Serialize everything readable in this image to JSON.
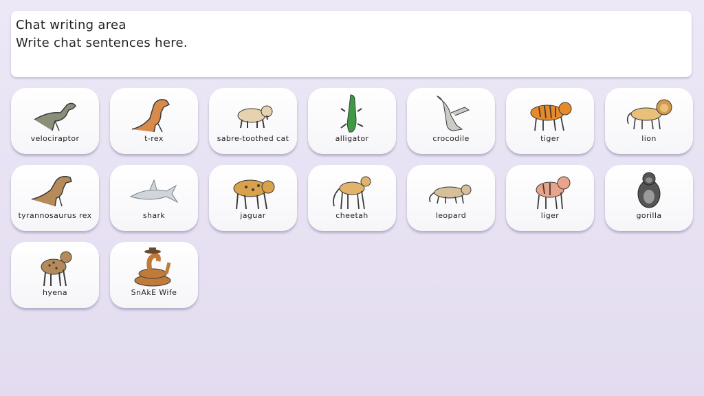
{
  "chat": {
    "title": "Chat writing area",
    "placeholder": "Write chat sentences here."
  },
  "tiles": [
    {
      "label": "velociraptor",
      "icon": "velociraptor-icon",
      "color": "#8a8f7a"
    },
    {
      "label": "t-rex",
      "icon": "t-rex-icon",
      "color": "#d88a4a"
    },
    {
      "label": "sabre-toothed cat",
      "icon": "sabre-toothed-cat-icon",
      "color": "#e6d2b0"
    },
    {
      "label": "alligator",
      "icon": "alligator-icon",
      "color": "#3e9a43"
    },
    {
      "label": "crocodile",
      "icon": "crocodile-icon",
      "color": "#c9ccc4"
    },
    {
      "label": "tiger",
      "icon": "tiger-icon",
      "color": "#e88a2a"
    },
    {
      "label": "lion",
      "icon": "lion-icon",
      "color": "#e8c07a"
    },
    {
      "label": "tyrannosaurus rex",
      "icon": "tyrannosaurus-rex-icon",
      "color": "#b78a5a"
    },
    {
      "label": "shark",
      "icon": "shark-icon",
      "color": "#cfd5da"
    },
    {
      "label": "jaguar",
      "icon": "jaguar-icon",
      "color": "#d9a14a"
    },
    {
      "label": "cheetah",
      "icon": "cheetah-icon",
      "color": "#e2b46a"
    },
    {
      "label": "leopard",
      "icon": "leopard-icon",
      "color": "#d6c09a"
    },
    {
      "label": "liger",
      "icon": "liger-icon",
      "color": "#e8a48a"
    },
    {
      "label": "gorilla",
      "icon": "gorilla-icon",
      "color": "#555555"
    },
    {
      "label": "hyena",
      "icon": "hyena-icon",
      "color": "#b58a5a"
    },
    {
      "label": "SnAkE Wife",
      "icon": "snake-icon",
      "color": "#c07a3a"
    }
  ]
}
